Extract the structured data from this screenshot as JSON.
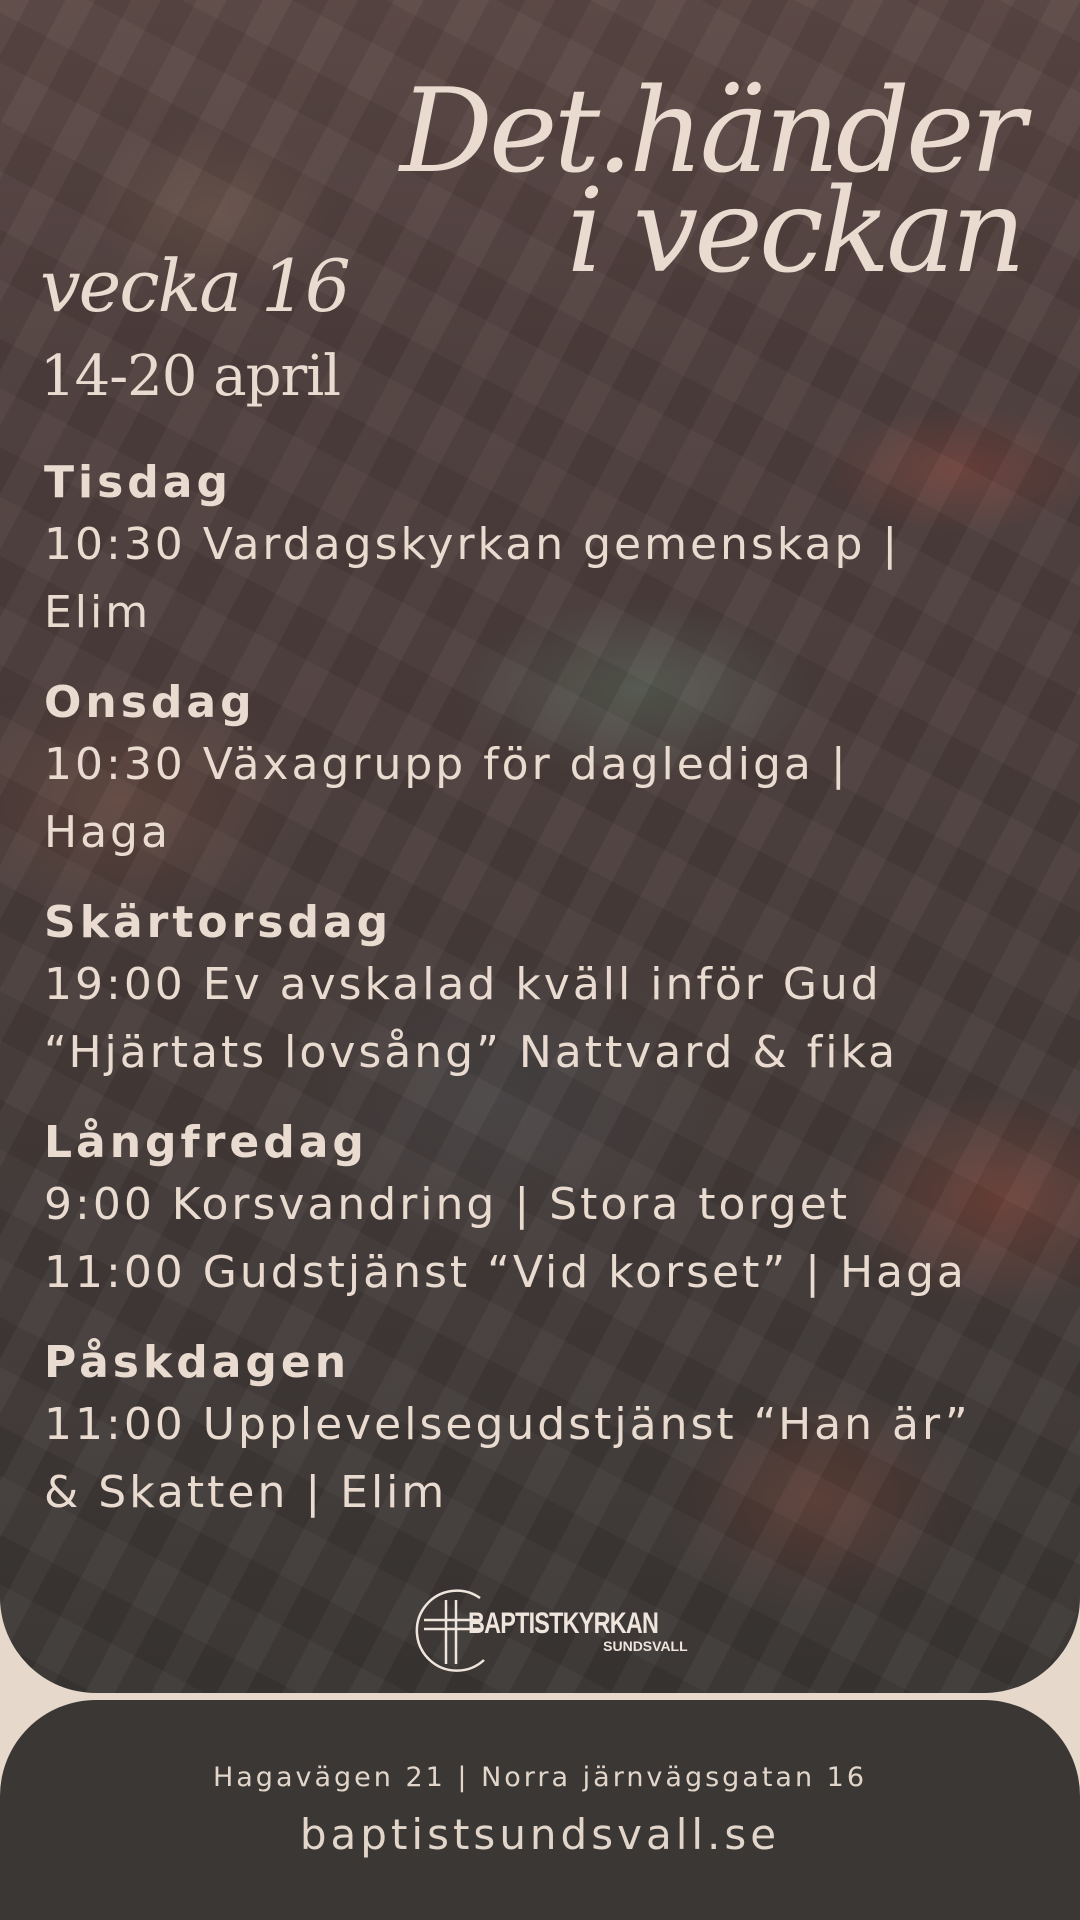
{
  "header": {
    "title_line1": "Det.händer",
    "title_line2": "i veckan",
    "week": "vecka 16",
    "date_range": "14-20  april"
  },
  "schedule": [
    {
      "day": "Tisdag",
      "lines": [
        "10:30 Vardagskyrkan gemenskap |",
        "Elim"
      ]
    },
    {
      "day": "Onsdag",
      "lines": [
        "10:30 Växagrupp för daglediga |",
        "Haga"
      ]
    },
    {
      "day": "Skärtorsdag",
      "lines": [
        "19:00 Ev avskalad kväll inför Gud",
        "“Hjärtats lovsång” Nattvard & fika"
      ]
    },
    {
      "day": "Långfredag",
      "lines": [
        "9:00 Korsvandring | Stora torget",
        "11:00 Gudstjänst “Vid korset” | Haga"
      ]
    },
    {
      "day": "Påskdagen",
      "lines": [
        "11:00 Upplevelsegudstjänst “Han är”",
        "& Skatten | Elim"
      ]
    }
  ],
  "logo": {
    "name": "BAPTISTKYRKAN",
    "city": "SUNDSVALL",
    "icon": "cross-circle-icon"
  },
  "footer": {
    "address": "Hagavägen 21 | Norra järnvägsgatan 16",
    "website": "baptistsundsvall.se"
  },
  "colors": {
    "text": "#e9dbcf",
    "panel": "#3b3735",
    "background": "#e6d8cb"
  }
}
